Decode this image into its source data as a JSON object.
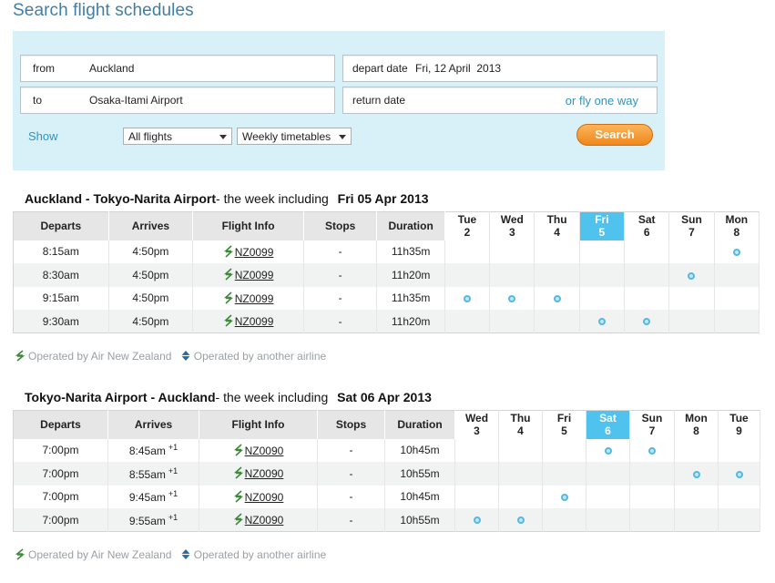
{
  "page": {
    "title": "Search flight schedules"
  },
  "search": {
    "from_label": "from",
    "from_value": "Auckland",
    "to_label": "to",
    "to_value": "Osaka-Itami Airport",
    "depart_label": "depart date",
    "depart_value": "Fri, 12 April  2013",
    "return_label": "return date",
    "fly_one_way": "or fly one way",
    "show_label": "Show",
    "filter_select": "All flights",
    "timetable_select": "Weekly timetables",
    "search_button": "Search"
  },
  "legend": {
    "air_nz": "Operated by Air New Zealand",
    "other": "Operated by another airline"
  },
  "colors": {
    "accent": "#4fc2ee",
    "link": "#2d95c4",
    "button": "#f0861a",
    "panel": "#d8f0f8"
  },
  "sections": [
    {
      "route": "Auckland - Tokyo-Narita Airport",
      "note": "- the week including",
      "week_date": "Fri 05 Apr 2013",
      "headers": [
        "Departs",
        "Arrives",
        "Flight Info",
        "Stops",
        "Duration"
      ],
      "days": [
        {
          "name": "Tue",
          "num": "2"
        },
        {
          "name": "Wed",
          "num": "3"
        },
        {
          "name": "Thu",
          "num": "4"
        },
        {
          "name": "Fri",
          "num": "5",
          "highlight": true
        },
        {
          "name": "Sat",
          "num": "6"
        },
        {
          "name": "Sun",
          "num": "7"
        },
        {
          "name": "Mon",
          "num": "8"
        }
      ],
      "rows": [
        {
          "departs": "8:15am",
          "arrives": "4:50pm",
          "plus": "",
          "flight": "NZ0099",
          "stops": "-",
          "duration": "11h35m",
          "days": [
            false,
            false,
            false,
            false,
            false,
            false,
            true
          ]
        },
        {
          "departs": "8:30am",
          "arrives": "4:50pm",
          "plus": "",
          "flight": "NZ0099",
          "stops": "-",
          "duration": "11h20m",
          "days": [
            false,
            false,
            false,
            false,
            false,
            true,
            false
          ]
        },
        {
          "departs": "9:15am",
          "arrives": "4:50pm",
          "plus": "",
          "flight": "NZ0099",
          "stops": "-",
          "duration": "11h35m",
          "days": [
            true,
            true,
            true,
            false,
            false,
            false,
            false
          ]
        },
        {
          "departs": "9:30am",
          "arrives": "4:50pm",
          "plus": "",
          "flight": "NZ0099",
          "stops": "-",
          "duration": "11h20m",
          "days": [
            false,
            false,
            false,
            true,
            true,
            false,
            false
          ]
        }
      ]
    },
    {
      "route": "Tokyo-Narita Airport - Auckland",
      "note": "- the week including",
      "week_date": "Sat 06 Apr 2013",
      "headers": [
        "Departs",
        "Arrives",
        "Flight Info",
        "Stops",
        "Duration"
      ],
      "days": [
        {
          "name": "Wed",
          "num": "3"
        },
        {
          "name": "Thu",
          "num": "4"
        },
        {
          "name": "Fri",
          "num": "5"
        },
        {
          "name": "Sat",
          "num": "6",
          "highlight": true
        },
        {
          "name": "Sun",
          "num": "7"
        },
        {
          "name": "Mon",
          "num": "8"
        },
        {
          "name": "Tue",
          "num": "9"
        }
      ],
      "rows": [
        {
          "departs": "7:00pm",
          "arrives": "8:45am",
          "plus": "+1",
          "flight": "NZ0090",
          "stops": "-",
          "duration": "10h45m",
          "days": [
            false,
            false,
            false,
            true,
            true,
            false,
            false
          ]
        },
        {
          "departs": "7:00pm",
          "arrives": "8:55am",
          "plus": "+1",
          "flight": "NZ0090",
          "stops": "-",
          "duration": "10h55m",
          "days": [
            false,
            false,
            false,
            false,
            false,
            true,
            true
          ]
        },
        {
          "departs": "7:00pm",
          "arrives": "9:45am",
          "plus": "+1",
          "flight": "NZ0090",
          "stops": "-",
          "duration": "10h45m",
          "days": [
            false,
            false,
            true,
            false,
            false,
            false,
            false
          ]
        },
        {
          "departs": "7:00pm",
          "arrives": "9:55am",
          "plus": "+1",
          "flight": "NZ0090",
          "stops": "-",
          "duration": "10h55m",
          "days": [
            true,
            true,
            false,
            false,
            false,
            false,
            false
          ]
        }
      ]
    }
  ]
}
